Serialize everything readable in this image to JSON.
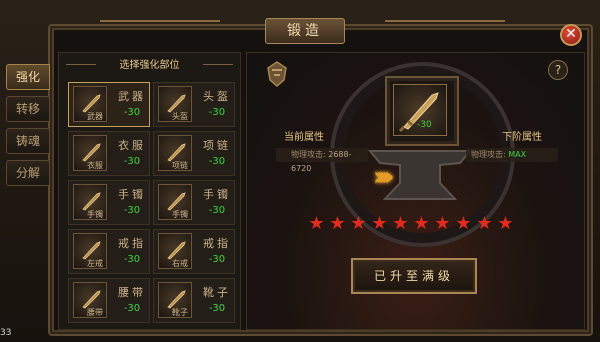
{
  "window": {
    "title": "锻造",
    "close_icon": "close-icon"
  },
  "side_tabs": [
    {
      "label": "强化",
      "active": true
    },
    {
      "label": "转移",
      "active": false
    },
    {
      "label": "铸魂",
      "active": false
    },
    {
      "label": "分解",
      "active": false
    }
  ],
  "left_panel": {
    "title": "选择强化部位",
    "slots": [
      {
        "name": "武器",
        "mini": "武器",
        "level": "-30",
        "selected": true,
        "icon": "weapon-icon"
      },
      {
        "name": "头盔",
        "mini": "头盔",
        "level": "-30",
        "selected": false,
        "icon": "helmet-icon"
      },
      {
        "name": "衣服",
        "mini": "衣服",
        "level": "-30",
        "selected": false,
        "icon": "armor-icon"
      },
      {
        "name": "项链",
        "mini": "项链",
        "level": "-30",
        "selected": false,
        "icon": "necklace-icon"
      },
      {
        "name": "手镯",
        "mini": "手镯",
        "level": "-30",
        "selected": false,
        "icon": "bracelet-icon"
      },
      {
        "name": "手镯",
        "mini": "手镯",
        "level": "-30",
        "selected": false,
        "icon": "bracelet-icon"
      },
      {
        "name": "戒指",
        "mini": "左戒",
        "level": "-30",
        "selected": false,
        "icon": "ring-icon"
      },
      {
        "name": "戒指",
        "mini": "右戒",
        "level": "-30",
        "selected": false,
        "icon": "ring-icon"
      },
      {
        "name": "腰带",
        "mini": "腰带",
        "level": "-30",
        "selected": false,
        "icon": "belt-icon"
      },
      {
        "name": "靴子",
        "mini": "靴子",
        "level": "-30",
        "selected": false,
        "icon": "boots-icon"
      }
    ]
  },
  "right_panel": {
    "preview_level": "-30",
    "current_label": "当前属性",
    "next_label": "下阶属性",
    "current_stat_name": "物理攻击:",
    "current_stat_value": "2688-6720",
    "next_stat_name": "物理攻击:",
    "next_stat_value": "MAX",
    "stars": [
      "★",
      "★",
      "★",
      "★",
      "★",
      "★",
      "★",
      "★",
      "★",
      "★"
    ],
    "max_button": "已升至满级",
    "help": "?"
  },
  "corner": "33",
  "colors": {
    "accent": "#e9c57e",
    "level": "#3ad53a",
    "star": "#e42a1d"
  }
}
